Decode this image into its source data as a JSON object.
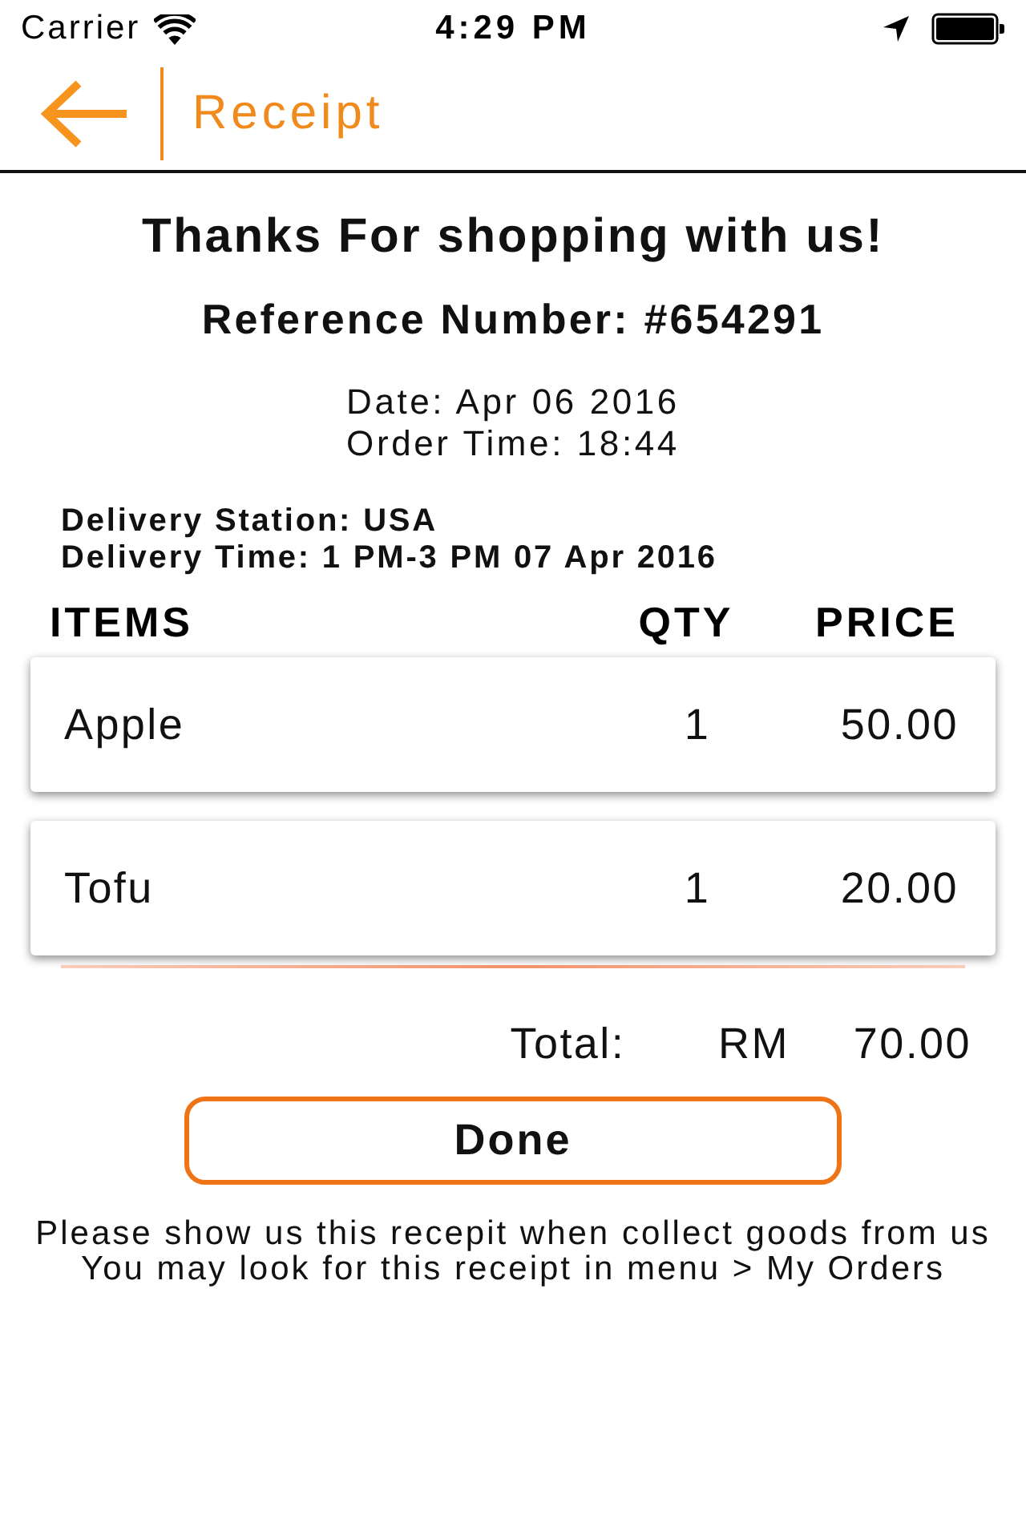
{
  "status_bar": {
    "carrier": "Carrier",
    "time": "4:29 PM"
  },
  "nav_bar": {
    "title": "Receipt"
  },
  "receipt": {
    "heading": "Thanks For shopping with us!",
    "reference": "Reference Number: #654291",
    "date": "Date: Apr 06 2016",
    "order_time": "Order Time: 18:44",
    "delivery_station": "Delivery Station: USA",
    "delivery_time": "Delivery Time: 1 PM-3 PM 07 Apr 2016"
  },
  "table": {
    "columns": [
      "ITEMS",
      "QTY",
      "PRICE"
    ],
    "rows": [
      {
        "item": "Apple",
        "qty": "1",
        "price": "50.00"
      },
      {
        "item": "Tofu",
        "qty": "1",
        "price": "20.00"
      }
    ]
  },
  "total": {
    "label": "Total:",
    "currency": "RM",
    "amount": "70.00"
  },
  "done_button": {
    "label": "Done"
  },
  "footer": [
    "Please show us this recepit when collect goods from us",
    "You may look for this receipt in menu > My Orders"
  ]
}
